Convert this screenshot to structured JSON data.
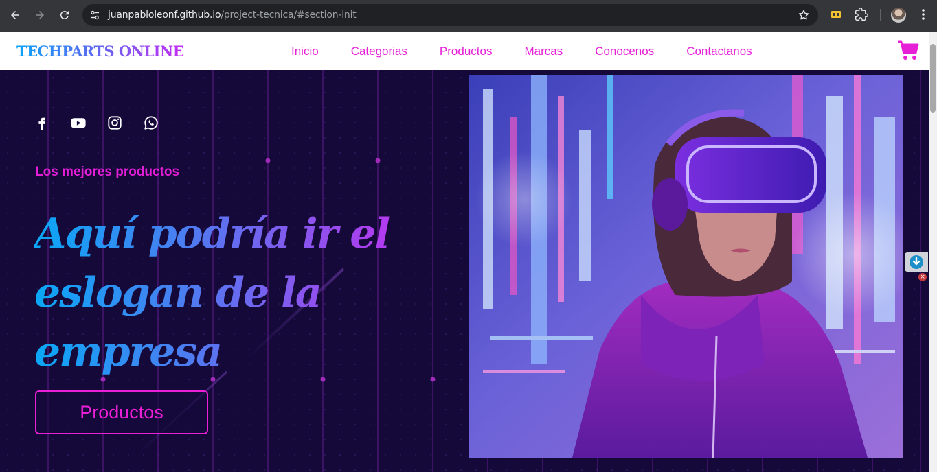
{
  "browser": {
    "url_host": "juanpabloleonf.github.io",
    "url_path": "/project-tecnica/#section-init"
  },
  "site": {
    "logo": "TECHPARTS ONLINE",
    "nav": [
      "Inicio",
      "Categorias",
      "Productos",
      "Marcas",
      "Conocenos",
      "Contactanos"
    ]
  },
  "hero": {
    "socials": [
      "facebook-icon",
      "youtube-icon",
      "instagram-icon",
      "whatsapp-icon"
    ],
    "tagline": "Los mejores productos",
    "slogan": "Aquí podría ir el eslogan de la empresa",
    "cta_label": "Productos"
  },
  "colors": {
    "accent": "#e71fd6",
    "hero_bg": "#15093a",
    "gradient_start": "#0aa2f7",
    "gradient_end": "#c42ef2"
  }
}
